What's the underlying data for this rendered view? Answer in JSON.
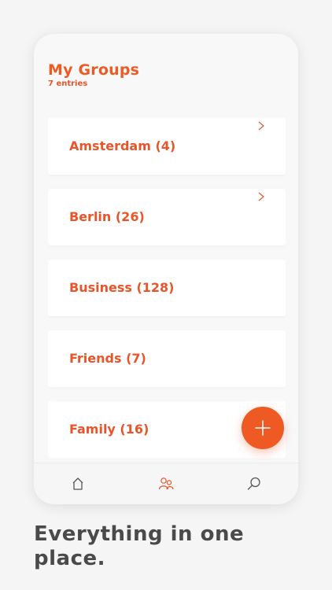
{
  "header": {
    "title": "My Groups",
    "entries": "7 entries"
  },
  "groups": [
    {
      "label": "Amsterdam (4)"
    },
    {
      "label": "Berlin (26)"
    },
    {
      "label": "Business (128)"
    },
    {
      "label": "Friends (7)"
    },
    {
      "label": "Family (16)"
    }
  ],
  "fab": {
    "icon": "plus-icon"
  },
  "tabs": [
    {
      "icon": "home-icon",
      "active": false
    },
    {
      "icon": "people-icon",
      "active": true
    },
    {
      "icon": "search-icon",
      "active": false
    }
  ],
  "tagline": "Everything in one place.",
  "colors": {
    "accent": "#ef5a24",
    "background": "#f5f5f5",
    "card": "#ffffff",
    "tagline": "#4a4a4a",
    "icon_inactive": "#555555",
    "icon_active": "#e8552a"
  }
}
